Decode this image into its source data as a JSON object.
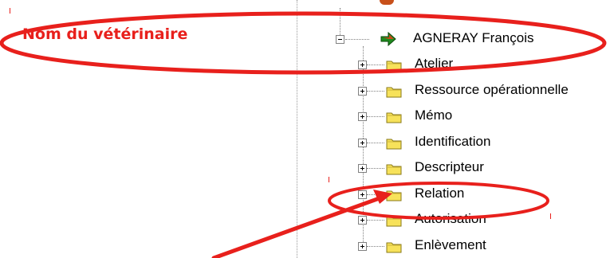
{
  "annotation": {
    "title": "Nom du vétérinaire",
    "color": "#e8201c"
  },
  "tree": {
    "root": {
      "label": "AGNERAY François",
      "icon": "green-arrow-icon"
    },
    "items": [
      {
        "label": "Atelier",
        "icon": "folder-icon"
      },
      {
        "label": "Ressource opérationnelle",
        "icon": "folder-icon"
      },
      {
        "label": "Mémo",
        "icon": "folder-icon"
      },
      {
        "label": "Identification",
        "icon": "folder-icon"
      },
      {
        "label": "Descripteur",
        "icon": "folder-icon"
      },
      {
        "label": "Relation",
        "icon": "folder-icon"
      },
      {
        "label": "Autorisation",
        "icon": "folder-icon"
      },
      {
        "label": "Enlèvement",
        "icon": "folder-icon"
      }
    ]
  }
}
